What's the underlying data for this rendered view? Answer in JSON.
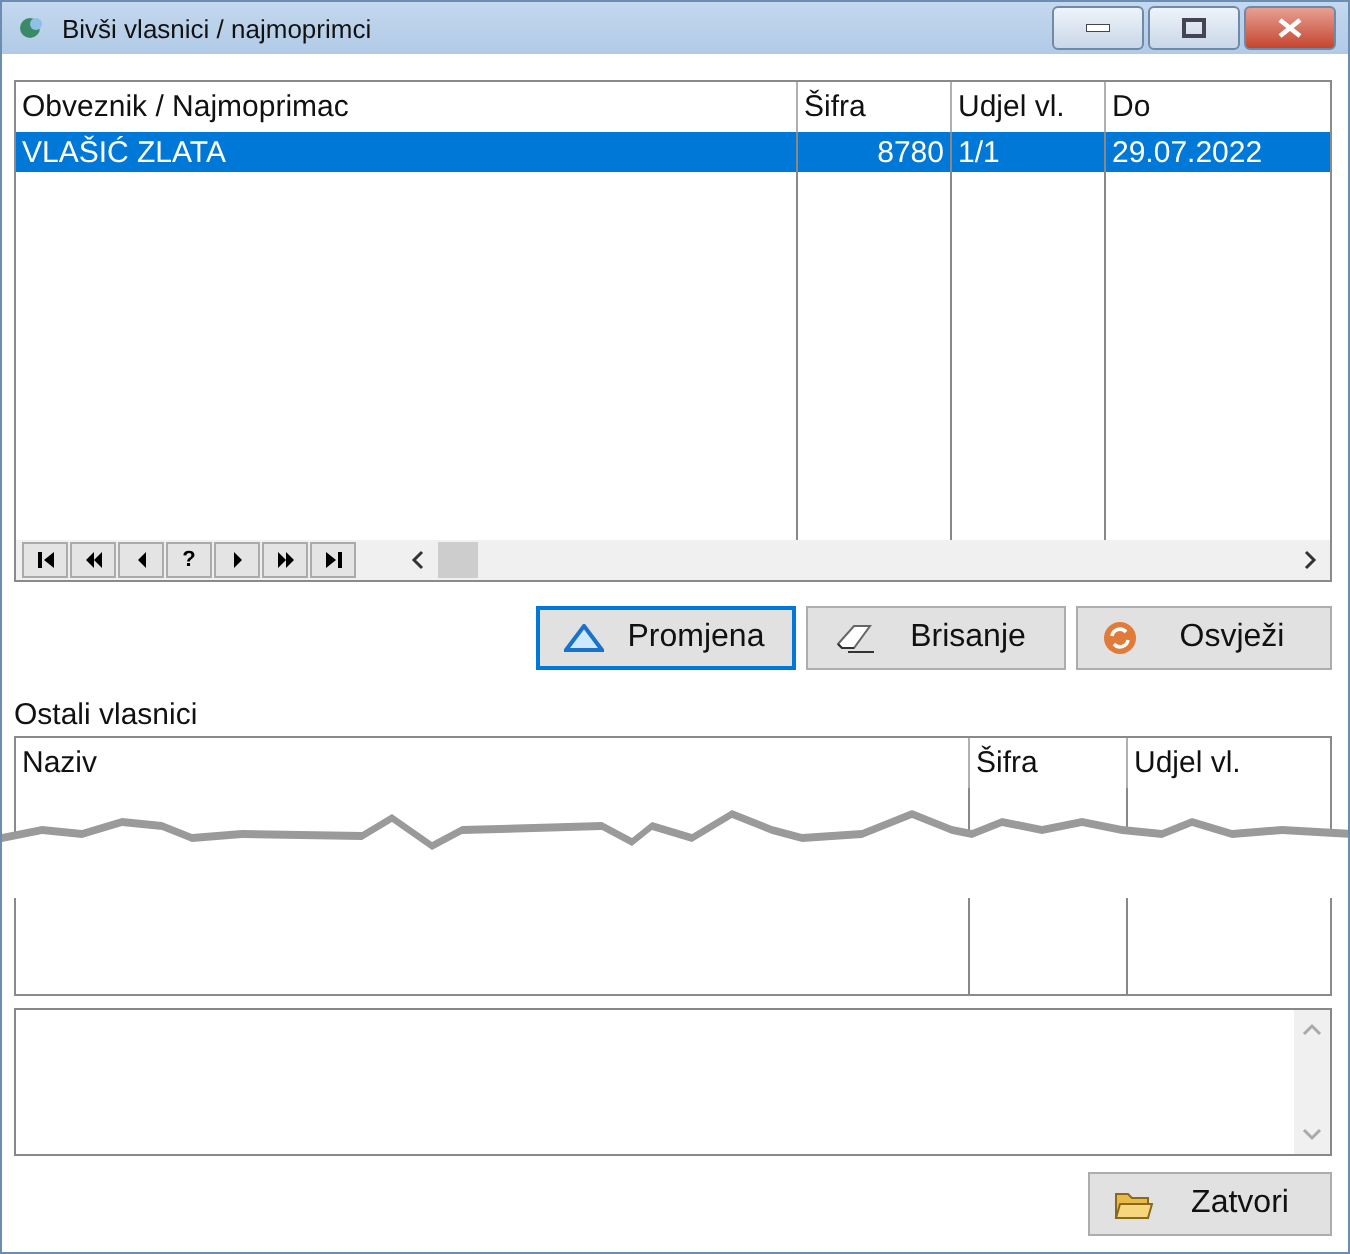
{
  "window": {
    "title": "Bivši vlasnici / najmoprimci"
  },
  "former_owners": {
    "columns": [
      "Obveznik / Najmoprimac",
      "Šifra",
      "Udjel vl.",
      "Do"
    ],
    "rows": [
      {
        "cells": [
          "VLAŠIĆ ZLATA",
          "8780",
          "1/1",
          "29.07.2022"
        ],
        "selected": true
      }
    ],
    "navigator": [
      {
        "kind": "first"
      },
      {
        "kind": "prev-page"
      },
      {
        "kind": "prev"
      },
      {
        "kind": "text",
        "label": "?"
      },
      {
        "kind": "next"
      },
      {
        "kind": "next-page"
      },
      {
        "kind": "last"
      }
    ]
  },
  "actions": [
    {
      "label": "Promjena",
      "kind": "edit",
      "focused": true
    },
    {
      "label": "Brisanje",
      "kind": "erase",
      "focused": false
    },
    {
      "label": "Osvježi",
      "kind": "refresh",
      "focused": false
    }
  ],
  "other_owners": {
    "label": "Ostali vlasnici",
    "columns": [
      "Naziv",
      "Šifra",
      "Udjel vl."
    ]
  },
  "close_button": {
    "label": "Zatvori"
  }
}
